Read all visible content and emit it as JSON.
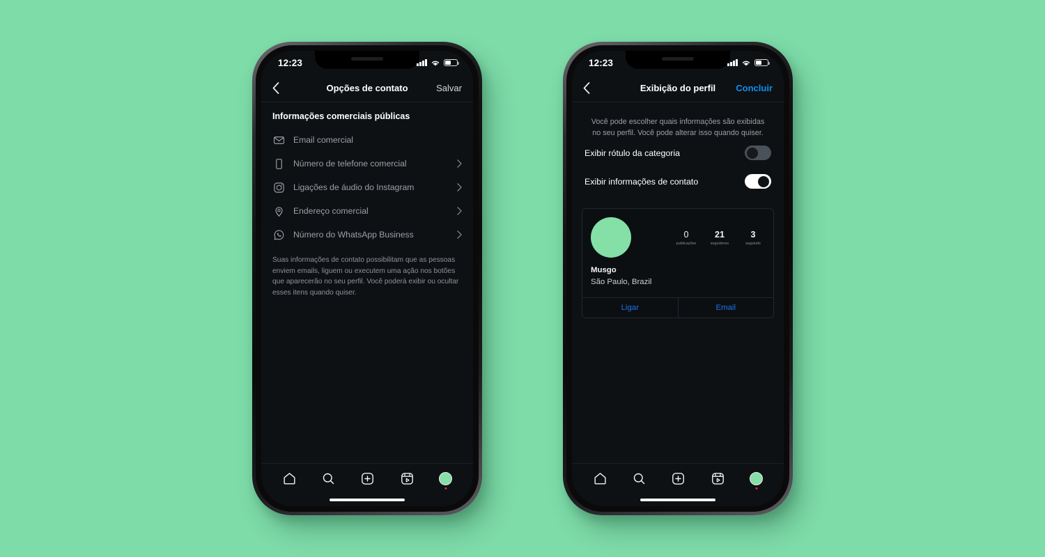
{
  "background_color": "#7edca9",
  "accent_blue": "#0e8fef",
  "brand_green": "#84e0a7",
  "phones": [
    {
      "id": "contact-options",
      "status_bar": {
        "time": "12:23",
        "signal_icon": "signal-bars-icon",
        "wifi_icon": "wifi-icon",
        "battery_icon": "battery-icon"
      },
      "navbar": {
        "back_icon": "chevron-left-icon",
        "title": "Opções de contato",
        "action_label": "Salvar",
        "action_is_blue": false
      },
      "section_title": "Informações comerciais públicas",
      "rows": [
        {
          "icon": "envelope-icon",
          "label": "Email comercial",
          "chevron": false
        },
        {
          "icon": "phone-icon",
          "label": "Número de telefone comercial",
          "chevron": true
        },
        {
          "icon": "instagram-icon",
          "label": "Ligações de áudio do Instagram",
          "chevron": true
        },
        {
          "icon": "location-pin-icon",
          "label": "Endereço comercial",
          "chevron": true
        },
        {
          "icon": "whatsapp-icon",
          "label": "Número do WhatsApp Business",
          "chevron": true
        }
      ],
      "footnote": "Suas informações de contato possibilitam que as pessoas enviem emails, liguem ou executem uma ação nos botões que aparecerão no seu perfil. Você poderá exibir ou ocultar esses itens quando quiser."
    },
    {
      "id": "profile-display",
      "status_bar": {
        "time": "12:23",
        "signal_icon": "signal-bars-icon",
        "wifi_icon": "wifi-icon",
        "battery_icon": "battery-icon"
      },
      "navbar": {
        "back_icon": "chevron-left-icon",
        "title": "Exibição do perfil",
        "action_label": "Concluir",
        "action_is_blue": true
      },
      "description": "Você pode escolher quais informações são exibidas no seu perfil. Você pode alterar isso quando quiser.",
      "toggles": [
        {
          "label": "Exibir rótulo da categoria",
          "state": "off"
        },
        {
          "label": "Exibir informações de contato",
          "state": "on"
        }
      ],
      "profile_card": {
        "avatar": "profile-avatar",
        "name": "Musgo",
        "location": "São Paulo, Brazil",
        "stats": [
          {
            "value": "0",
            "label": "publicações"
          },
          {
            "value": "21",
            "label": "seguidores"
          },
          {
            "value": "3",
            "label": "seguindo"
          }
        ],
        "actions": [
          {
            "label": "Ligar"
          },
          {
            "label": "Email"
          }
        ]
      }
    }
  ],
  "tabbar": {
    "items": [
      {
        "icon": "home-icon",
        "name": "tab-home"
      },
      {
        "icon": "search-icon",
        "name": "tab-search"
      },
      {
        "icon": "plus-square-icon",
        "name": "tab-create"
      },
      {
        "icon": "reels-icon",
        "name": "tab-reels"
      },
      {
        "icon": "avatar-icon",
        "name": "tab-profile"
      }
    ]
  }
}
